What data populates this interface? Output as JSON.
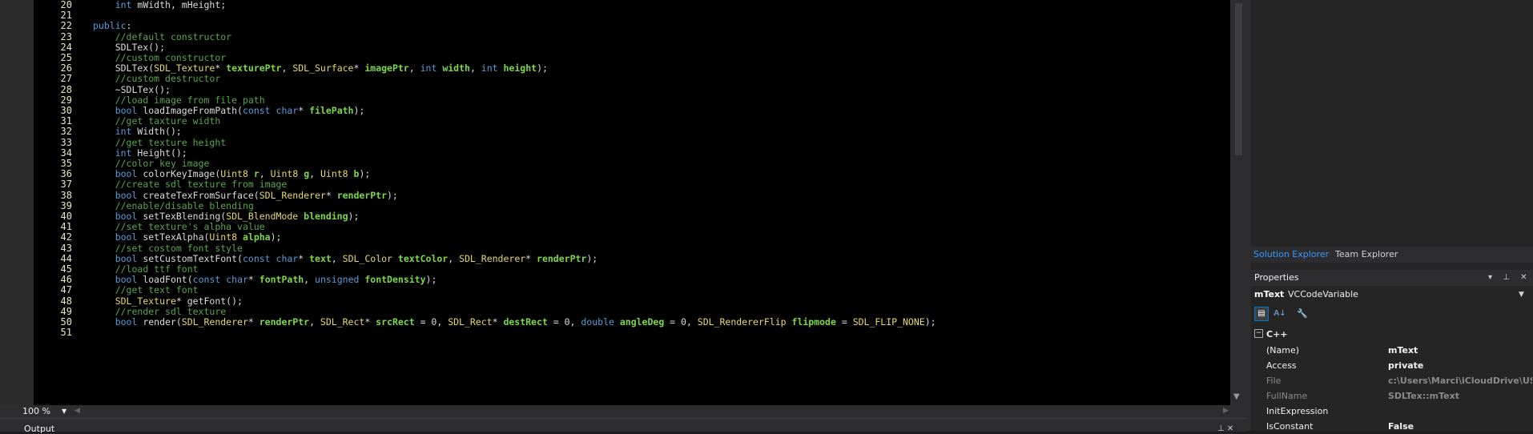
{
  "editor": {
    "lines": [
      {
        "num": "20",
        "tokens": [
          {
            "t": "    "
          },
          {
            "t": "int",
            "c": "kw"
          },
          {
            "t": " mWidth, mHeight;"
          }
        ]
      },
      {
        "num": "21",
        "tokens": []
      },
      {
        "num": "22",
        "tokens": [
          {
            "t": "public",
            "c": "kw"
          },
          {
            "t": ":"
          }
        ]
      },
      {
        "num": "23",
        "tokens": [
          {
            "t": "    "
          },
          {
            "t": "//default constructor",
            "c": "cm"
          }
        ]
      },
      {
        "num": "24",
        "tokens": [
          {
            "t": "    SDLTex();"
          }
        ]
      },
      {
        "num": "25",
        "tokens": [
          {
            "t": "    "
          },
          {
            "t": "//custom constructor",
            "c": "cm"
          }
        ]
      },
      {
        "num": "26",
        "tokens": [
          {
            "t": "    SDLTex("
          },
          {
            "t": "SDL_Texture",
            "c": "type"
          },
          {
            "t": "* "
          },
          {
            "t": "texturePtr",
            "c": "param"
          },
          {
            "t": ", "
          },
          {
            "t": "SDL_Surface",
            "c": "type"
          },
          {
            "t": "* "
          },
          {
            "t": "imagePtr",
            "c": "param"
          },
          {
            "t": ", "
          },
          {
            "t": "int",
            "c": "kw"
          },
          {
            "t": " "
          },
          {
            "t": "width",
            "c": "param"
          },
          {
            "t": ", "
          },
          {
            "t": "int",
            "c": "kw"
          },
          {
            "t": " "
          },
          {
            "t": "height",
            "c": "param"
          },
          {
            "t": ");"
          }
        ]
      },
      {
        "num": "27",
        "tokens": [
          {
            "t": "    "
          },
          {
            "t": "//custom destructor",
            "c": "cm"
          }
        ]
      },
      {
        "num": "28",
        "tokens": [
          {
            "t": "    ~SDLTex();"
          }
        ]
      },
      {
        "num": "29",
        "tokens": [
          {
            "t": "    "
          },
          {
            "t": "//load image from file path",
            "c": "cm"
          }
        ]
      },
      {
        "num": "30",
        "tokens": [
          {
            "t": "    "
          },
          {
            "t": "bool",
            "c": "kw"
          },
          {
            "t": " loadImageFromPath("
          },
          {
            "t": "const",
            "c": "kw"
          },
          {
            "t": " "
          },
          {
            "t": "char",
            "c": "kw"
          },
          {
            "t": "* "
          },
          {
            "t": "filePath",
            "c": "param"
          },
          {
            "t": ");"
          }
        ]
      },
      {
        "num": "31",
        "tokens": [
          {
            "t": "    "
          },
          {
            "t": "//get taxture width",
            "c": "cm"
          }
        ]
      },
      {
        "num": "32",
        "tokens": [
          {
            "t": "    "
          },
          {
            "t": "int",
            "c": "kw"
          },
          {
            "t": " Width();"
          }
        ]
      },
      {
        "num": "33",
        "tokens": [
          {
            "t": "    "
          },
          {
            "t": "//get texture height",
            "c": "cm"
          }
        ]
      },
      {
        "num": "34",
        "tokens": [
          {
            "t": "    "
          },
          {
            "t": "int",
            "c": "kw"
          },
          {
            "t": " Height();"
          }
        ]
      },
      {
        "num": "35",
        "tokens": [
          {
            "t": "    "
          },
          {
            "t": "//color key image",
            "c": "cm"
          }
        ]
      },
      {
        "num": "36",
        "tokens": [
          {
            "t": "    "
          },
          {
            "t": "bool",
            "c": "kw"
          },
          {
            "t": " colorKeyImage("
          },
          {
            "t": "Uint8",
            "c": "type"
          },
          {
            "t": " "
          },
          {
            "t": "r",
            "c": "param"
          },
          {
            "t": ", "
          },
          {
            "t": "Uint8",
            "c": "type"
          },
          {
            "t": " "
          },
          {
            "t": "g",
            "c": "param"
          },
          {
            "t": ", "
          },
          {
            "t": "Uint8",
            "c": "type"
          },
          {
            "t": " "
          },
          {
            "t": "b",
            "c": "param"
          },
          {
            "t": ");"
          }
        ]
      },
      {
        "num": "37",
        "tokens": [
          {
            "t": "    "
          },
          {
            "t": "//create sdl texture from image",
            "c": "cm"
          }
        ]
      },
      {
        "num": "38",
        "tokens": [
          {
            "t": "    "
          },
          {
            "t": "bool",
            "c": "kw"
          },
          {
            "t": " createTexFromSurface("
          },
          {
            "t": "SDL_Renderer",
            "c": "type"
          },
          {
            "t": "* "
          },
          {
            "t": "renderPtr",
            "c": "param"
          },
          {
            "t": ");"
          }
        ]
      },
      {
        "num": "39",
        "tokens": [
          {
            "t": "    "
          },
          {
            "t": "//enable/disable blending",
            "c": "cm"
          }
        ]
      },
      {
        "num": "40",
        "tokens": [
          {
            "t": "    "
          },
          {
            "t": "bool",
            "c": "kw"
          },
          {
            "t": " setTexBlending("
          },
          {
            "t": "SDL_BlendMode",
            "c": "type"
          },
          {
            "t": " "
          },
          {
            "t": "blending",
            "c": "param"
          },
          {
            "t": ");"
          }
        ]
      },
      {
        "num": "41",
        "tokens": [
          {
            "t": "    "
          },
          {
            "t": "//set texture's alpha value",
            "c": "cm"
          }
        ]
      },
      {
        "num": "42",
        "tokens": [
          {
            "t": "    "
          },
          {
            "t": "bool",
            "c": "kw"
          },
          {
            "t": " setTexAlpha("
          },
          {
            "t": "Uint8",
            "c": "type"
          },
          {
            "t": " "
          },
          {
            "t": "alpha",
            "c": "param"
          },
          {
            "t": ");"
          }
        ]
      },
      {
        "num": "43",
        "tokens": [
          {
            "t": "    "
          },
          {
            "t": "//set costom font style",
            "c": "cm"
          }
        ]
      },
      {
        "num": "44",
        "tokens": [
          {
            "t": "    "
          },
          {
            "t": "bool",
            "c": "kw"
          },
          {
            "t": " setCustomTextFont("
          },
          {
            "t": "const",
            "c": "kw"
          },
          {
            "t": " "
          },
          {
            "t": "char",
            "c": "kw"
          },
          {
            "t": "* "
          },
          {
            "t": "text",
            "c": "param"
          },
          {
            "t": ", "
          },
          {
            "t": "SDL_Color",
            "c": "type"
          },
          {
            "t": " "
          },
          {
            "t": "textColor",
            "c": "param"
          },
          {
            "t": ", "
          },
          {
            "t": "SDL_Renderer",
            "c": "type"
          },
          {
            "t": "* "
          },
          {
            "t": "renderPtr",
            "c": "param"
          },
          {
            "t": ");"
          }
        ]
      },
      {
        "num": "45",
        "tokens": [
          {
            "t": "    "
          },
          {
            "t": "//load ttf font",
            "c": "cm"
          }
        ]
      },
      {
        "num": "46",
        "tokens": [
          {
            "t": "    "
          },
          {
            "t": "bool",
            "c": "kw"
          },
          {
            "t": " loadFont("
          },
          {
            "t": "const",
            "c": "kw"
          },
          {
            "t": " "
          },
          {
            "t": "char",
            "c": "kw"
          },
          {
            "t": "* "
          },
          {
            "t": "fontPath",
            "c": "param"
          },
          {
            "t": ", "
          },
          {
            "t": "unsigned",
            "c": "kw"
          },
          {
            "t": " "
          },
          {
            "t": "fontDensity",
            "c": "param"
          },
          {
            "t": ");"
          }
        ]
      },
      {
        "num": "47",
        "tokens": [
          {
            "t": "    "
          },
          {
            "t": "//get text font",
            "c": "cm"
          }
        ]
      },
      {
        "num": "48",
        "tokens": [
          {
            "t": "    "
          },
          {
            "t": "SDL_Texture",
            "c": "type"
          },
          {
            "t": "* getFont();"
          }
        ]
      },
      {
        "num": "49",
        "tokens": [
          {
            "t": "    "
          },
          {
            "t": "//render sdl texture",
            "c": "cm"
          }
        ]
      },
      {
        "num": "50",
        "tokens": [
          {
            "t": "    "
          },
          {
            "t": "bool",
            "c": "kw"
          },
          {
            "t": " render("
          },
          {
            "t": "SDL_Renderer",
            "c": "type"
          },
          {
            "t": "* "
          },
          {
            "t": "renderPtr",
            "c": "param"
          },
          {
            "t": ", "
          },
          {
            "t": "SDL_Rect",
            "c": "type"
          },
          {
            "t": "* "
          },
          {
            "t": "srcRect",
            "c": "param"
          },
          {
            "t": " = 0, "
          },
          {
            "t": "SDL_Rect",
            "c": "type"
          },
          {
            "t": "* "
          },
          {
            "t": "destRect",
            "c": "param"
          },
          {
            "t": " = 0, "
          },
          {
            "t": "double",
            "c": "kw"
          },
          {
            "t": " "
          },
          {
            "t": "angleDeg",
            "c": "param"
          },
          {
            "t": " = 0, "
          },
          {
            "t": "SDL_RendererFlip",
            "c": "type"
          },
          {
            "t": " "
          },
          {
            "t": "flipmode",
            "c": "param"
          },
          {
            "t": " = "
          },
          {
            "t": "SDL_FLIP_NONE",
            "c": "type"
          },
          {
            "t": ");"
          }
        ]
      },
      {
        "num": "51",
        "tokens": []
      }
    ]
  },
  "statusbar": {
    "zoom": "100 %"
  },
  "output": {
    "label": "Output"
  },
  "solution_tabs": [
    {
      "label": "Solution Explorer"
    },
    {
      "label": "Team Explorer"
    }
  ],
  "properties": {
    "title": "Properties",
    "object_name": "mText",
    "object_type": "VCCodeVariable",
    "category": "C++",
    "rows": [
      {
        "name": "(Name)",
        "value": "mText",
        "dim": false
      },
      {
        "name": "Access",
        "value": "private",
        "dim": false
      },
      {
        "name": "File",
        "value": "c:\\Users\\Marci\\iCloudDrive\\USD",
        "dim": true
      },
      {
        "name": "FullName",
        "value": "SDLTex::mText",
        "dim": true
      },
      {
        "name": "InitExpression",
        "value": "",
        "dim": false
      },
      {
        "name": "IsConstant",
        "value": "False",
        "dim": false
      }
    ]
  },
  "colors": {
    "keyword": "#569cd6",
    "comment": "#57a64a",
    "type": "#e6d96a",
    "param": "#7cd84a",
    "accent": "#3399ff"
  }
}
